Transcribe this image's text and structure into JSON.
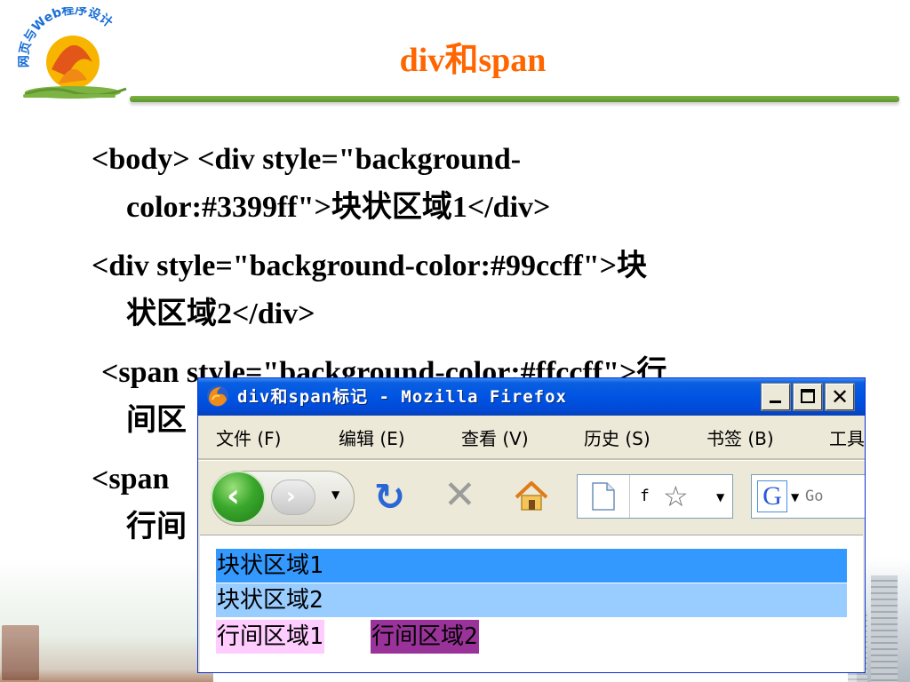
{
  "slide": {
    "logo_text": "网页与Web程序设计",
    "title": "div和span",
    "accent_title_color": "#ff6600",
    "accent_rule_color": "#7cb342",
    "paragraphs": [
      {
        "line1": "<body> <div style=\"background-",
        "line2": "color:#3399ff\">块状区域1</div>"
      },
      {
        "line1": "<div style=\"background-color:#99ccff\">块",
        "line2": "状区域2</div>"
      },
      {
        "line1": "<span style=\"background-color:#ffccff\">行",
        "line2": "间区"
      },
      {
        "line1": "<span",
        "line2": "行间"
      }
    ]
  },
  "browser": {
    "window_title": "div和span标记 - Mozilla Firefox",
    "title_bar_color": "#0054e3",
    "window_buttons": {
      "minimize": "minimize-icon",
      "maximize": "maximize-icon",
      "close": "✕"
    },
    "menu": [
      {
        "label": "文件 (F)"
      },
      {
        "label": "编辑 (E)"
      },
      {
        "label": "查看 (V)"
      },
      {
        "label": "历史 (S)"
      },
      {
        "label": "书签 (B)"
      },
      {
        "label": "工具"
      }
    ],
    "toolbar": {
      "back_icon": "back-arrow-icon",
      "forward_icon": "forward-arrow-icon",
      "reload_icon": "reload-icon",
      "stop_icon": "stop-icon",
      "home_icon": "home-icon",
      "address_value": "f",
      "bookmark_icon": "star-icon",
      "search_engine_label": "G",
      "search_placeholder": "Go"
    },
    "content": {
      "blocks": [
        {
          "text": "块状区域1",
          "background": "#3399ff"
        },
        {
          "text": "块状区域2",
          "background": "#99ccff"
        }
      ],
      "inlines": [
        {
          "text": "行间区域1",
          "background": "#ffccff"
        },
        {
          "text": "行间区域2",
          "background": "#993399"
        }
      ]
    }
  }
}
